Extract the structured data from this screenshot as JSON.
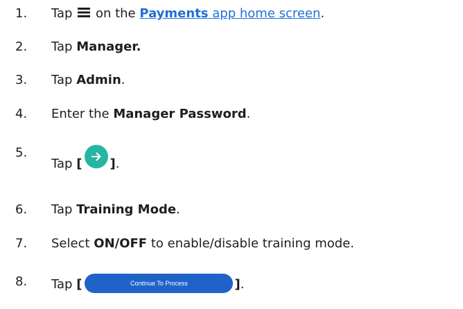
{
  "steps": [
    {
      "number": "1.",
      "pre": "Tap",
      "icon": "hamburger-menu-icon",
      "mid": "on the",
      "link_bold": "Payments",
      "link_rest": "app home screen",
      "end": "."
    },
    {
      "number": "2.",
      "pre": "Tap",
      "bold": "Manager.",
      "end": ""
    },
    {
      "number": "3.",
      "pre": "Tap",
      "bold": "Admin",
      "end": "."
    },
    {
      "number": "4.",
      "pre": "Enter the",
      "bold": "Manager Password",
      "end": "."
    },
    {
      "number": "5.",
      "pre": "Tap",
      "open": "[",
      "icon": "arrow-right-circle-icon",
      "icon_color": "#27b5a3",
      "close": "]",
      "end": "."
    },
    {
      "number": "6.",
      "pre": "Tap",
      "bold": "Training Mode",
      "end": "."
    },
    {
      "number": "7.",
      "pre": "Select",
      "bold": "ON/OFF",
      "rest": "to enable/disable training mode."
    },
    {
      "number": "8.",
      "pre": "Tap",
      "open": "[",
      "button_label": "Continue To Process",
      "button_color": "#1f63c9",
      "close": "]",
      "end": "."
    }
  ]
}
